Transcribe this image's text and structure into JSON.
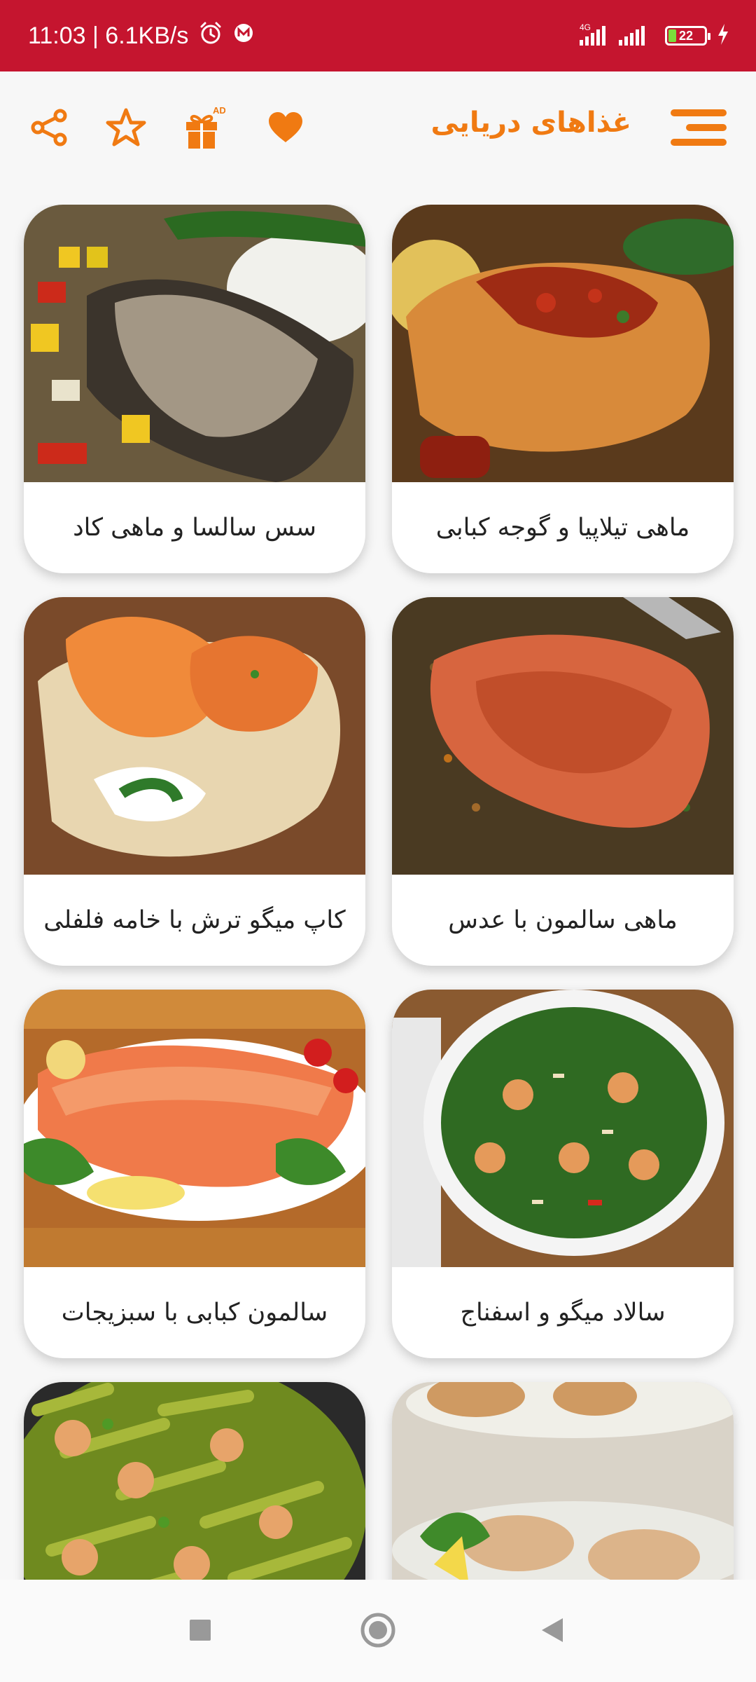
{
  "status_bar": {
    "time_speed": "11:03 | 6.1KB/s",
    "network_label": "4G",
    "battery_level": "22",
    "icons": [
      "alarm-icon",
      "app-m-icon",
      "signal-icon",
      "battery-icon",
      "charging-icon"
    ]
  },
  "app_bar": {
    "title": "غذاهای دریایی",
    "ad_badge": "AD",
    "icons": [
      "menu-icon",
      "heart-icon",
      "gift-icon",
      "star-icon",
      "share-icon"
    ],
    "accent_color": "#f07a12"
  },
  "colors": {
    "status_bar_bg": "#c5152f",
    "accent": "#f07a12",
    "card_bg": "#ffffff",
    "label_text": "#222222"
  },
  "recipes": [
    {
      "title": "ماهی تیلاپیا و گوجه کبابی"
    },
    {
      "title": "سس سالسا و ماهی کاد"
    },
    {
      "title": "ماهی سالمون با عدس"
    },
    {
      "title": "کاپ میگو ترش با خامه فلفلی"
    },
    {
      "title": "سالاد میگو و اسفناج"
    },
    {
      "title": "سالمون کبابی با سبزیجات"
    },
    {
      "title": ""
    },
    {
      "title": ""
    }
  ],
  "nav_bar": {
    "icons": [
      "recent-apps-icon",
      "home-icon",
      "back-icon"
    ]
  }
}
